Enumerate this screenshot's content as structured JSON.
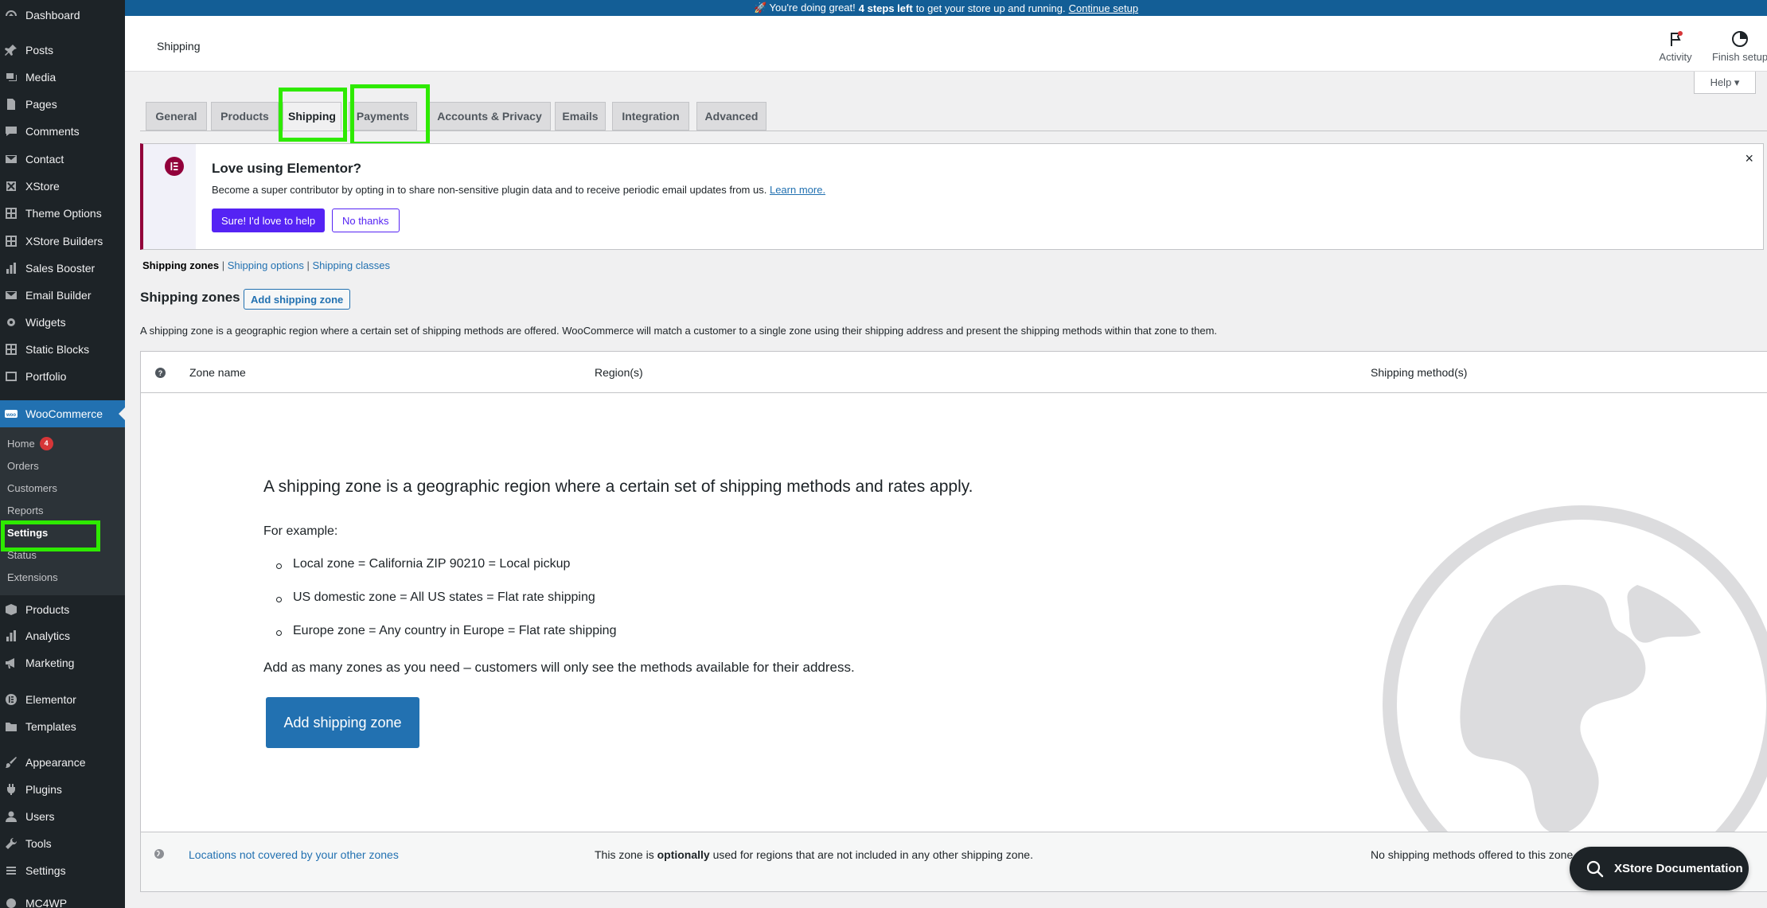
{
  "notice_bar": {
    "prefix": "🚀 You're doing great!",
    "bold": "4 steps left",
    "suffix": "to get your store up and running.",
    "link": "Continue setup"
  },
  "sidebar": {
    "items": [
      {
        "label": "Dashboard",
        "icon": "dashboard-icon"
      },
      {
        "label": "Posts",
        "icon": "pin-icon"
      },
      {
        "label": "Media",
        "icon": "media-icon"
      },
      {
        "label": "Pages",
        "icon": "page-icon"
      },
      {
        "label": "Comments",
        "icon": "comment-icon"
      },
      {
        "label": "Contact",
        "icon": "mail-icon"
      },
      {
        "label": "XStore",
        "icon": "xstore-icon"
      },
      {
        "label": "Theme Options",
        "icon": "grid-icon"
      },
      {
        "label": "XStore Builders",
        "icon": "grid-icon"
      },
      {
        "label": "Sales Booster",
        "icon": "chart-icon"
      },
      {
        "label": "Email Builder",
        "icon": "mail-icon"
      },
      {
        "label": "Widgets",
        "icon": "gear-icon"
      },
      {
        "label": "Static Blocks",
        "icon": "grid-icon"
      },
      {
        "label": "Portfolio",
        "icon": "portfolio-icon"
      },
      {
        "label": "WooCommerce",
        "icon": "woo-icon"
      },
      {
        "label": "Products",
        "icon": "box-icon"
      },
      {
        "label": "Analytics",
        "icon": "chart-icon"
      },
      {
        "label": "Marketing",
        "icon": "megaphone-icon"
      },
      {
        "label": "Elementor",
        "icon": "elementor-icon"
      },
      {
        "label": "Templates",
        "icon": "folder-icon"
      },
      {
        "label": "Appearance",
        "icon": "brush-icon"
      },
      {
        "label": "Plugins",
        "icon": "plugin-icon"
      },
      {
        "label": "Users",
        "icon": "user-icon"
      },
      {
        "label": "Tools",
        "icon": "wrench-icon"
      },
      {
        "label": "Settings",
        "icon": "settings-icon"
      },
      {
        "label": "MC4WP",
        "icon": "mc4wp-icon"
      }
    ],
    "woo_submenu": [
      {
        "label": "Home",
        "badge": "4"
      },
      {
        "label": "Orders"
      },
      {
        "label": "Customers"
      },
      {
        "label": "Reports"
      },
      {
        "label": "Settings"
      },
      {
        "label": "Status"
      },
      {
        "label": "Extensions"
      }
    ]
  },
  "header": {
    "title": "Shipping",
    "activity": "Activity",
    "finish_setup": "Finish setup",
    "help": "Help ▾"
  },
  "tabs": [
    "General",
    "Products",
    "Shipping",
    "Payments",
    "Accounts & Privacy",
    "Emails",
    "Integration",
    "Advanced"
  ],
  "active_tab": "Shipping",
  "elementor_notice": {
    "title": "Love using Elementor?",
    "description": "Become a super contributor by opting in to share non-sensitive plugin data and to receive periodic email updates from us.",
    "learn_more": "Learn more.",
    "yes_button": "Sure! I'd love to help",
    "no_button": "No thanks",
    "close": "×",
    "accent_color": "#92003b",
    "button_color": "#5523f4"
  },
  "subsubsub": {
    "current": "Shipping zones",
    "sep": "|",
    "options": "Shipping options",
    "classes": "Shipping classes"
  },
  "zones": {
    "heading": "Shipping zones",
    "add_button": "Add shipping zone",
    "description": "A shipping zone is a geographic region where a certain set of shipping methods are offered. WooCommerce will match a customer to a single zone using their shipping address and present the shipping methods within that zone to them."
  },
  "table": {
    "help_glyph": "?",
    "col_zone_name": "Zone name",
    "col_regions": "Region(s)",
    "col_methods": "Shipping method(s)",
    "blank": {
      "title": "A shipping zone is a geographic region where a certain set of shipping methods and rates apply.",
      "example_label": "For example:",
      "examples": [
        "Local zone = California ZIP 90210 = Local pickup",
        "US domestic zone = All US states = Flat rate shipping",
        "Europe zone = Any country in Europe = Flat rate shipping"
      ],
      "more": "Add as many zones as you need – customers will only see the methods available for their address.",
      "button": "Add shipping zone"
    },
    "footer": {
      "location_link": "Locations not covered by your other zones",
      "opt_prefix": "This zone is",
      "opt_bold": "optionally",
      "opt_suffix": "used for regions that are not included in any other shipping zone.",
      "no_methods": "No shipping methods offered to this zone."
    }
  },
  "xstore_docs": "XStore Documentation"
}
